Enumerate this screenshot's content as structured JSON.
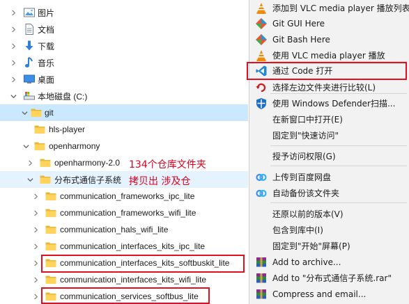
{
  "tree": {
    "items": [
      {
        "label": "图片",
        "icon": "pictures-folder-icon"
      },
      {
        "label": "文档",
        "icon": "documents-folder-icon"
      },
      {
        "label": "下载",
        "icon": "downloads-folder-icon"
      },
      {
        "label": "音乐",
        "icon": "music-folder-icon"
      },
      {
        "label": "桌面",
        "icon": "desktop-folder-icon"
      },
      {
        "label": "本地磁盘 (C:)",
        "icon": "local-disk-icon"
      },
      {
        "label": "git",
        "icon": "folder-icon"
      },
      {
        "label": "hls-player",
        "icon": "folder-icon"
      },
      {
        "label": "openharmony",
        "icon": "folder-icon"
      },
      {
        "label": "openharmony-2.0",
        "icon": "folder-icon"
      },
      {
        "label": "分布式通信子系统",
        "icon": "folder-icon"
      },
      {
        "label": "communication_frameworks_ipc_lite",
        "icon": "folder-icon"
      },
      {
        "label": "communication_frameworks_wifi_lite",
        "icon": "folder-icon"
      },
      {
        "label": "communication_hals_wifi_lite",
        "icon": "folder-icon"
      },
      {
        "label": "communication_interfaces_kits_ipc_lite",
        "icon": "folder-icon"
      },
      {
        "label": "communication_interfaces_kits_softbuskit_lite",
        "icon": "folder-icon"
      },
      {
        "label": "communication_interfaces_kits_wifi_lite",
        "icon": "folder-icon"
      },
      {
        "label": "communication_services_softbus_lite",
        "icon": "folder-icon"
      }
    ],
    "annotations": {
      "repo_count": "134个仓库文件夹",
      "copy_out": "拷贝出 涉及仓"
    }
  },
  "menu": {
    "items": [
      {
        "label": "添加到 VLC media player 播放列表",
        "icon": "vlc-icon"
      },
      {
        "label": "Git GUI Here",
        "icon": "git-gui-icon"
      },
      {
        "label": "Git Bash Here",
        "icon": "git-bash-icon"
      },
      {
        "label": "使用 VLC media player 播放",
        "icon": "vlc-icon"
      },
      {
        "label": "通过 Code 打开",
        "icon": "vscode-icon"
      },
      {
        "label": "选择左边文件夹进行比较(L)",
        "icon": "compare-icon"
      },
      {
        "label": "使用 Windows Defender扫描...",
        "icon": "defender-shield-icon"
      },
      {
        "label": "在新窗口中打开(E)",
        "icon": ""
      },
      {
        "label": "固定到\"快速访问\"",
        "icon": ""
      },
      {
        "label": "授予访问权限(G)",
        "icon": ""
      },
      {
        "label": "上传到百度网盘",
        "icon": "baidu-netdisk-icon"
      },
      {
        "label": "自动备份该文件夹",
        "icon": "baidu-netdisk-icon"
      },
      {
        "label": "还原以前的版本(V)",
        "icon": ""
      },
      {
        "label": "包含到库中(I)",
        "icon": ""
      },
      {
        "label": "固定到\"开始\"屏幕(P)",
        "icon": ""
      },
      {
        "label": "Add to archive...",
        "icon": "winrar-icon"
      },
      {
        "label": "Add to \"分布式通信子系统.rar\"",
        "icon": "winrar-icon"
      },
      {
        "label": "Compress and email...",
        "icon": "winrar-icon"
      }
    ]
  },
  "colors": {
    "selection": "#cce8ff",
    "hover": "#e5f3ff",
    "annotation_red": "#e0001b",
    "folder_yellow": "#ffd35c",
    "menu_bg": "#f2f2f2"
  }
}
